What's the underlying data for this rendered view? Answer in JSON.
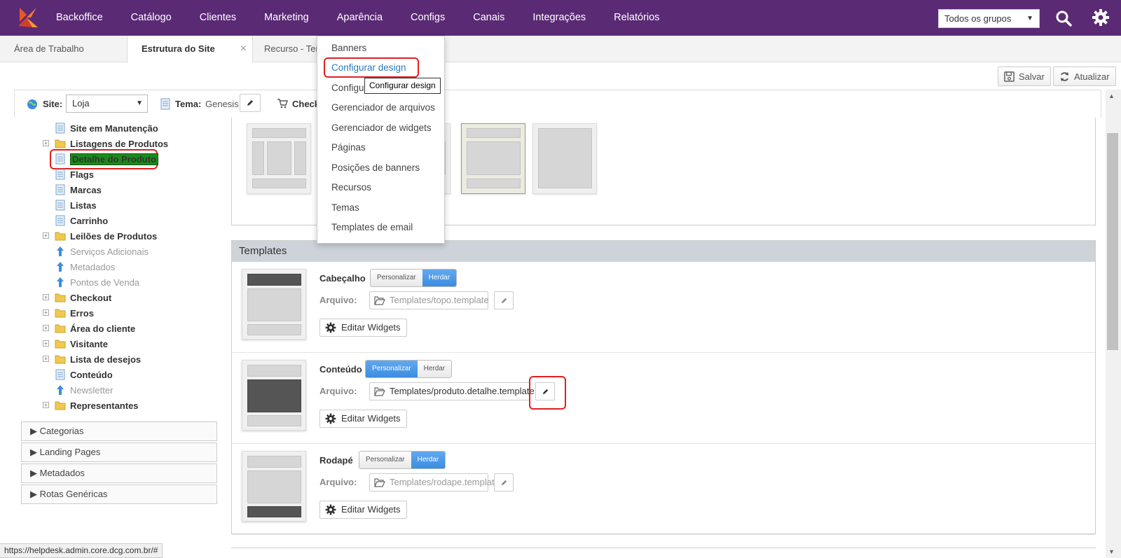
{
  "nav": {
    "items": [
      "Backoffice",
      "Catálogo",
      "Clientes",
      "Marketing",
      "Aparência",
      "Configs",
      "Canais",
      "Integrações",
      "Relatórios"
    ],
    "group_select": "Todos os grupos"
  },
  "tabs": [
    "Área de Trabalho",
    "Estrutura do Site",
    "Recurso - Tem"
  ],
  "toolbar": {
    "save": "Salvar",
    "refresh": "Atualizar"
  },
  "sitebar": {
    "site_label": "Site:",
    "site_value": "Loja",
    "tema_label": "Tema:",
    "tema_value": "Genesis",
    "checkout_label": "Check"
  },
  "tree": [
    {
      "label": "Site em Manutenção",
      "type": "page",
      "dim": false
    },
    {
      "label": "Listagens de Produtos",
      "type": "folder",
      "dim": false
    },
    {
      "label": "Detalhe do Produto",
      "type": "page",
      "dim": false,
      "selected": true
    },
    {
      "label": "Flags",
      "type": "page",
      "dim": false
    },
    {
      "label": "Marcas",
      "type": "page",
      "dim": false
    },
    {
      "label": "Listas",
      "type": "page",
      "dim": false
    },
    {
      "label": "Carrinho",
      "type": "page",
      "dim": false
    },
    {
      "label": "Leilões de Produtos",
      "type": "folder",
      "dim": false
    },
    {
      "label": "Serviços Adicionais",
      "type": "link",
      "dim": true
    },
    {
      "label": "Metadados",
      "type": "link",
      "dim": true
    },
    {
      "label": "Pontos de Venda",
      "type": "link",
      "dim": true
    },
    {
      "label": "Checkout",
      "type": "folder",
      "dim": false
    },
    {
      "label": "Erros",
      "type": "folder",
      "dim": false
    },
    {
      "label": "Área do cliente",
      "type": "folder",
      "dim": false
    },
    {
      "label": "Visitante",
      "type": "folder",
      "dim": false
    },
    {
      "label": "Lista de desejos",
      "type": "folder",
      "dim": false
    },
    {
      "label": "Conteúdo",
      "type": "page",
      "dim": false
    },
    {
      "label": "Newsletter",
      "type": "link",
      "dim": true
    },
    {
      "label": "Representantes",
      "type": "folder",
      "dim": false
    }
  ],
  "accordions": [
    "Categorias",
    "Landing Pages",
    "Metadados",
    "Rotas Genéricas"
  ],
  "templates": {
    "header": "Templates",
    "personalizar": "Personalizar",
    "herdar": "Herdar",
    "arquivo_label": "Arquivo:",
    "edit_widgets": "Editar Widgets",
    "rows": [
      {
        "name": "Cabeçalho",
        "file": "Templates/topo.template",
        "mode": "herdar"
      },
      {
        "name": "Conteúdo",
        "file": "Templates/produto.detalhe.template",
        "mode": "personalizar"
      },
      {
        "name": "Rodapé",
        "file": "Templates/rodape.template",
        "mode": "herdar"
      }
    ]
  },
  "dropdown": {
    "items": [
      "Banners",
      "Configurar design",
      "Configu",
      "Gerenciador de arquivos",
      "Gerenciador de widgets",
      "Páginas",
      "Posições de banners",
      "Recursos",
      "Temas",
      "Templates de email"
    ],
    "tooltip": "Configurar design"
  },
  "status_url": "https://helpdesk.admin.core.dcg.com.br/#",
  "colors": {
    "nav_bg": "#5a2a75",
    "accent_blue": "#3b8de0",
    "highlight_green": "#1a8a1a",
    "annotation_red": "#e02020"
  }
}
